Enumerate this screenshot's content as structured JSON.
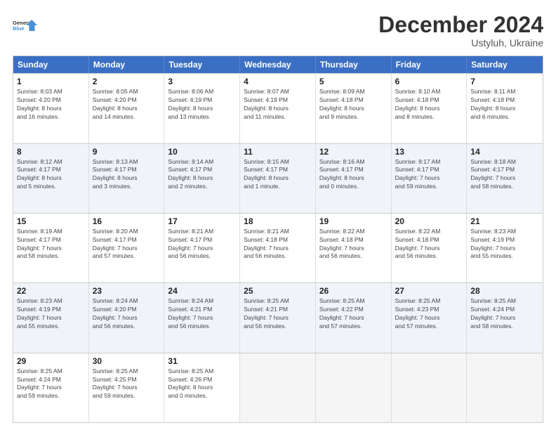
{
  "header": {
    "logo_line1": "General",
    "logo_line2": "Blue",
    "title": "December 2024",
    "subtitle": "Ustyluh, Ukraine"
  },
  "days_of_week": [
    "Sunday",
    "Monday",
    "Tuesday",
    "Wednesday",
    "Thursday",
    "Friday",
    "Saturday"
  ],
  "weeks": [
    [
      {
        "day": "1",
        "info": "Sunrise: 8:03 AM\nSunset: 4:20 PM\nDaylight: 8 hours\nand 16 minutes."
      },
      {
        "day": "2",
        "info": "Sunrise: 8:05 AM\nSunset: 4:20 PM\nDaylight: 8 hours\nand 14 minutes."
      },
      {
        "day": "3",
        "info": "Sunrise: 8:06 AM\nSunset: 4:19 PM\nDaylight: 8 hours\nand 13 minutes."
      },
      {
        "day": "4",
        "info": "Sunrise: 8:07 AM\nSunset: 4:19 PM\nDaylight: 8 hours\nand 11 minutes."
      },
      {
        "day": "5",
        "info": "Sunrise: 8:09 AM\nSunset: 4:18 PM\nDaylight: 8 hours\nand 9 minutes."
      },
      {
        "day": "6",
        "info": "Sunrise: 8:10 AM\nSunset: 4:18 PM\nDaylight: 8 hours\nand 8 minutes."
      },
      {
        "day": "7",
        "info": "Sunrise: 8:11 AM\nSunset: 4:18 PM\nDaylight: 8 hours\nand 6 minutes."
      }
    ],
    [
      {
        "day": "8",
        "info": "Sunrise: 8:12 AM\nSunset: 4:17 PM\nDaylight: 8 hours\nand 5 minutes."
      },
      {
        "day": "9",
        "info": "Sunrise: 8:13 AM\nSunset: 4:17 PM\nDaylight: 8 hours\nand 3 minutes."
      },
      {
        "day": "10",
        "info": "Sunrise: 8:14 AM\nSunset: 4:17 PM\nDaylight: 8 hours\nand 2 minutes."
      },
      {
        "day": "11",
        "info": "Sunrise: 8:15 AM\nSunset: 4:17 PM\nDaylight: 8 hours\nand 1 minute."
      },
      {
        "day": "12",
        "info": "Sunrise: 8:16 AM\nSunset: 4:17 PM\nDaylight: 8 hours\nand 0 minutes."
      },
      {
        "day": "13",
        "info": "Sunrise: 8:17 AM\nSunset: 4:17 PM\nDaylight: 7 hours\nand 59 minutes."
      },
      {
        "day": "14",
        "info": "Sunrise: 8:18 AM\nSunset: 4:17 PM\nDaylight: 7 hours\nand 58 minutes."
      }
    ],
    [
      {
        "day": "15",
        "info": "Sunrise: 8:19 AM\nSunset: 4:17 PM\nDaylight: 7 hours\nand 58 minutes."
      },
      {
        "day": "16",
        "info": "Sunrise: 8:20 AM\nSunset: 4:17 PM\nDaylight: 7 hours\nand 57 minutes."
      },
      {
        "day": "17",
        "info": "Sunrise: 8:21 AM\nSunset: 4:17 PM\nDaylight: 7 hours\nand 56 minutes."
      },
      {
        "day": "18",
        "info": "Sunrise: 8:21 AM\nSunset: 4:18 PM\nDaylight: 7 hours\nand 56 minutes."
      },
      {
        "day": "19",
        "info": "Sunrise: 8:22 AM\nSunset: 4:18 PM\nDaylight: 7 hours\nand 56 minutes."
      },
      {
        "day": "20",
        "info": "Sunrise: 8:22 AM\nSunset: 4:18 PM\nDaylight: 7 hours\nand 56 minutes."
      },
      {
        "day": "21",
        "info": "Sunrise: 8:23 AM\nSunset: 4:19 PM\nDaylight: 7 hours\nand 55 minutes."
      }
    ],
    [
      {
        "day": "22",
        "info": "Sunrise: 8:23 AM\nSunset: 4:19 PM\nDaylight: 7 hours\nand 55 minutes."
      },
      {
        "day": "23",
        "info": "Sunrise: 8:24 AM\nSunset: 4:20 PM\nDaylight: 7 hours\nand 56 minutes."
      },
      {
        "day": "24",
        "info": "Sunrise: 8:24 AM\nSunset: 4:21 PM\nDaylight: 7 hours\nand 56 minutes."
      },
      {
        "day": "25",
        "info": "Sunrise: 8:25 AM\nSunset: 4:21 PM\nDaylight: 7 hours\nand 56 minutes."
      },
      {
        "day": "26",
        "info": "Sunrise: 8:25 AM\nSunset: 4:22 PM\nDaylight: 7 hours\nand 57 minutes."
      },
      {
        "day": "27",
        "info": "Sunrise: 8:25 AM\nSunset: 4:23 PM\nDaylight: 7 hours\nand 57 minutes."
      },
      {
        "day": "28",
        "info": "Sunrise: 8:25 AM\nSunset: 4:24 PM\nDaylight: 7 hours\nand 58 minutes."
      }
    ],
    [
      {
        "day": "29",
        "info": "Sunrise: 8:25 AM\nSunset: 4:24 PM\nDaylight: 7 hours\nand 59 minutes."
      },
      {
        "day": "30",
        "info": "Sunrise: 8:25 AM\nSunset: 4:25 PM\nDaylight: 7 hours\nand 59 minutes."
      },
      {
        "day": "31",
        "info": "Sunrise: 8:25 AM\nSunset: 4:26 PM\nDaylight: 8 hours\nand 0 minutes."
      },
      {
        "day": "",
        "info": ""
      },
      {
        "day": "",
        "info": ""
      },
      {
        "day": "",
        "info": ""
      },
      {
        "day": "",
        "info": ""
      }
    ]
  ]
}
